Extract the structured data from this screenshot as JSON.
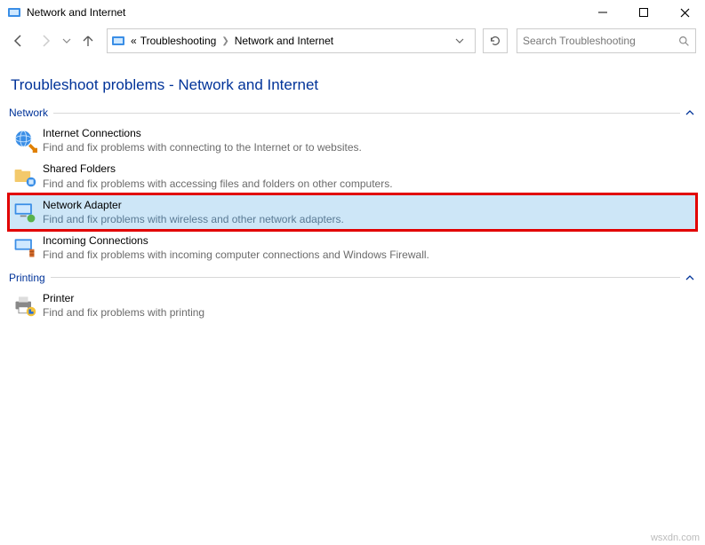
{
  "window": {
    "title": "Network and Internet"
  },
  "breadcrumb": {
    "prefix": "«",
    "items": [
      "Troubleshooting",
      "Network and Internet"
    ]
  },
  "search": {
    "placeholder": "Search Troubleshooting"
  },
  "page": {
    "title": "Troubleshoot problems - Network and Internet"
  },
  "sections": {
    "network": {
      "label": "Network",
      "items": [
        {
          "title": "Internet Connections",
          "desc": "Find and fix problems with connecting to the Internet or to websites."
        },
        {
          "title": "Shared Folders",
          "desc": "Find and fix problems with accessing files and folders on other computers."
        },
        {
          "title": "Network Adapter",
          "desc": "Find and fix problems with wireless and other network adapters.",
          "highlight": true
        },
        {
          "title": "Incoming Connections",
          "desc": "Find and fix problems with incoming computer connections and Windows Firewall."
        }
      ]
    },
    "printing": {
      "label": "Printing",
      "items": [
        {
          "title": "Printer",
          "desc": "Find and fix problems with printing"
        }
      ]
    }
  },
  "watermark": "wsxdn.com"
}
